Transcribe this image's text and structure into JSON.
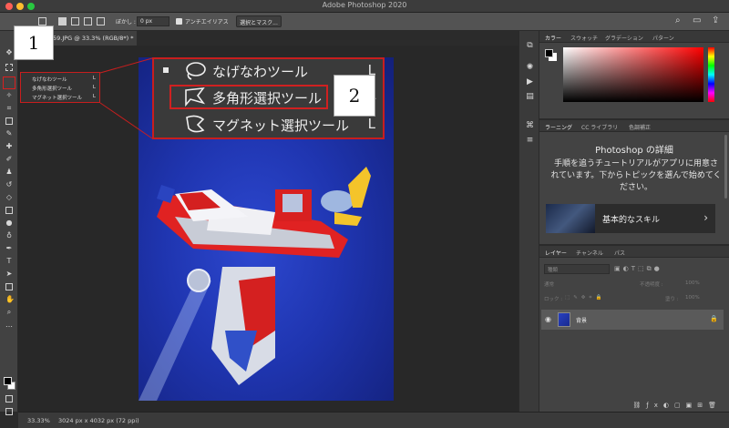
{
  "app": {
    "title": "Adobe Photoshop 2020"
  },
  "options_bar": {
    "feather_label": "ぼかし :",
    "feather_value": "0 px",
    "antialias_label": "アンチエイリアス",
    "select_mask_button": "選択とマスク..."
  },
  "document": {
    "tab_title": "59.JPG @ 33.3% (RGB/8*) *"
  },
  "status": {
    "zoom": "33.33%",
    "doc_info": "3024 px x 4032 px (72 ppi)"
  },
  "tool_flyout": {
    "items": [
      {
        "label": "なげなわツール",
        "key": "L"
      },
      {
        "label": "多角形選択ツール",
        "key": "L"
      },
      {
        "label": "マグネット選択ツール",
        "key": "L"
      }
    ]
  },
  "callouts": {
    "one": "1",
    "two": "2"
  },
  "color_panel": {
    "tabs": [
      "カラー",
      "スウォッチ",
      "グラデーション",
      "パターン"
    ]
  },
  "learn_panel": {
    "tabs": [
      "ラーニング",
      "CC ライブラリ",
      "色調補正"
    ],
    "title": "Photoshop の詳細",
    "description": "手順を追うチュートリアルがアプリに用意されています。下からトピックを選んで始めてください。",
    "card_label": "基本的なスキル"
  },
  "layers_panel": {
    "tabs": [
      "レイヤー",
      "チャンネル",
      "パス"
    ],
    "search_placeholder": "種類",
    "blend_mode": "通常",
    "opacity_label": "不透明度 :",
    "opacity_value": "100%",
    "lock_label": "ロック :",
    "fill_label": "塗り :",
    "fill_value": "100%",
    "layer_name": "背景"
  },
  "colors": {
    "accent_red": "#c81e1e"
  }
}
